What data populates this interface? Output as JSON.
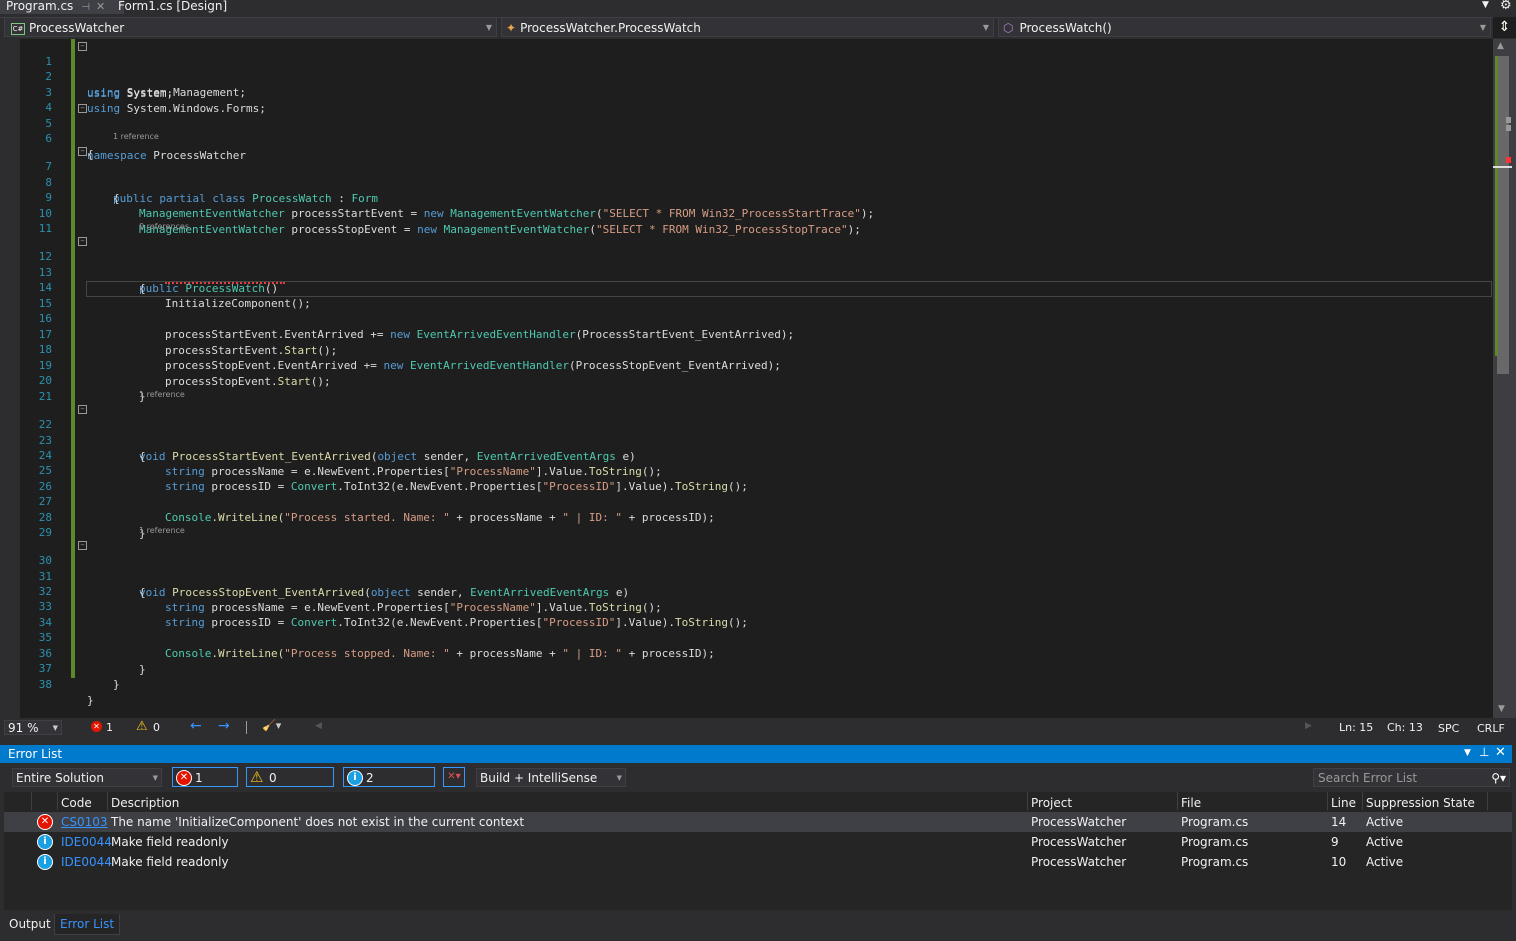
{
  "tabs": [
    {
      "label": "Program.cs",
      "active": true
    },
    {
      "label": "Form1.cs [Design]",
      "active": false
    }
  ],
  "navbar": {
    "project": "ProcessWatcher",
    "type": "ProcessWatcher.ProcessWatch",
    "member": "ProcessWatch()"
  },
  "editor": {
    "lines": [
      {
        "n": "1"
      },
      {
        "n": "2"
      },
      {
        "n": "3"
      },
      {
        "n": "4"
      },
      {
        "n": "5"
      },
      {
        "n": "6"
      },
      {
        "n": "7"
      },
      {
        "n": "8"
      },
      {
        "n": "9"
      },
      {
        "n": "10"
      },
      {
        "n": "11"
      },
      {
        "n": "12"
      },
      {
        "n": "13"
      },
      {
        "n": "14"
      },
      {
        "n": "15"
      },
      {
        "n": "16"
      },
      {
        "n": "17"
      },
      {
        "n": "18"
      },
      {
        "n": "19"
      },
      {
        "n": "20"
      },
      {
        "n": "21"
      },
      {
        "n": "22"
      },
      {
        "n": "23"
      },
      {
        "n": "24"
      },
      {
        "n": "25"
      },
      {
        "n": "26"
      },
      {
        "n": "27"
      },
      {
        "n": "28"
      },
      {
        "n": "29"
      },
      {
        "n": "30"
      },
      {
        "n": "31"
      },
      {
        "n": "32"
      },
      {
        "n": "33"
      },
      {
        "n": "34"
      },
      {
        "n": "35"
      },
      {
        "n": "36"
      },
      {
        "n": "37"
      },
      {
        "n": "38"
      }
    ],
    "codelens": {
      "class_refs": "1 reference",
      "ctor_refs": "0 references",
      "start_refs": "1 reference",
      "stop_refs": "1 reference"
    },
    "tokens": {
      "using": "using",
      "system": "System;",
      "system_mgmt": "System.Management;",
      "system_forms": "System.Windows.Forms;",
      "namespace": "namespace",
      "ns_name": "ProcessWatcher",
      "open_brace": "{",
      "close_brace": "}",
      "public": "public",
      "partial": "partial",
      "class": "class",
      "class_name": "ProcessWatch",
      "colon": " : ",
      "form": "Form",
      "mew": "ManagementEventWatcher",
      "start_field": " processStartEvent = ",
      "stop_field": " processStopEvent = ",
      "new": "new",
      "open_paren": "(",
      "start_query": "\"SELECT * FROM Win32_ProcessStartTrace\"",
      "stop_query": "\"SELECT * FROM Win32_ProcessStopTrace\"",
      "close_stmt": ");",
      "ctor_name": "ProcessWatch",
      "parens": "()",
      "init_call": "InitializeComponent",
      "call_end": "();",
      "start_evt_arrived": "processStartEvent.EventArrived += ",
      "stop_evt_arrived": "processStopEvent.EventArrived += ",
      "handler_type": "EventArrivedEventHandler",
      "start_handler_arg": "(ProcessStartEvent_EventArrived);",
      "stop_handler_arg": "(ProcessStopEvent_EventArrived);",
      "start_evt": "processStartEvent.",
      "stop_evt": "processStopEvent.",
      "start_method": "Start",
      "void": "void",
      "start_handler": "ProcessStartEvent_EventArrived",
      "stop_handler": "ProcessStopEvent_EventArrived",
      "object": "object",
      "sender": " sender, ",
      "args_type": "EventArrivedEventArgs",
      "args_end": " e)",
      "string": "string",
      "pname_assign": " processName = e.NewEvent.Properties[",
      "pname_key": "\"ProcessName\"",
      "value_tostring": "].Value.",
      "tostring": "ToString",
      "pid_assign": " processID = ",
      "convert": "Convert",
      "toint32": ".ToInt32(e.NewEvent.Properties[",
      "pid_key": "\"ProcessID\"",
      "value_close": "].Value).",
      "console": "Console",
      "writeline": ".WriteLine(",
      "started_msg": "\"Process started. Name: \"",
      "stopped_msg": "\"Process stopped. Name: \"",
      "plus_pname": " + processName + ",
      "id_msg": "\" | ID: \"",
      "plus_pid": " + processID);"
    }
  },
  "editor_status": {
    "zoom": "91 %",
    "errors": "1",
    "warnings": "0",
    "line": "Ln: 15",
    "col": "Ch: 13",
    "indent": "SPC",
    "eol": "CRLF"
  },
  "error_list": {
    "title": "Error List",
    "scope": "Entire Solution",
    "errors_btn": "1 Error",
    "warnings_btn": "0 Warnings",
    "messages_btn": "2 Messages",
    "build_filter": "Build + IntelliSense",
    "search_placeholder": "Search Error List",
    "columns": [
      "Code",
      "Description",
      "Project",
      "File",
      "Line",
      "Suppression State"
    ],
    "rows": [
      {
        "severity": "error",
        "code": "CS0103",
        "description": "The name 'InitializeComponent' does not exist in the current context",
        "project": "ProcessWatcher",
        "file": "Program.cs",
        "line": "14",
        "state": "Active"
      },
      {
        "severity": "info",
        "code": "IDE0044",
        "description": "Make field readonly",
        "project": "ProcessWatcher",
        "file": "Program.cs",
        "line": "9",
        "state": "Active"
      },
      {
        "severity": "info",
        "code": "IDE0044",
        "description": "Make field readonly",
        "project": "ProcessWatcher",
        "file": "Program.cs",
        "line": "10",
        "state": "Active"
      }
    ]
  },
  "bottom_tabs": [
    {
      "label": "Output",
      "active": false
    },
    {
      "label": "Error List",
      "active": true
    }
  ]
}
